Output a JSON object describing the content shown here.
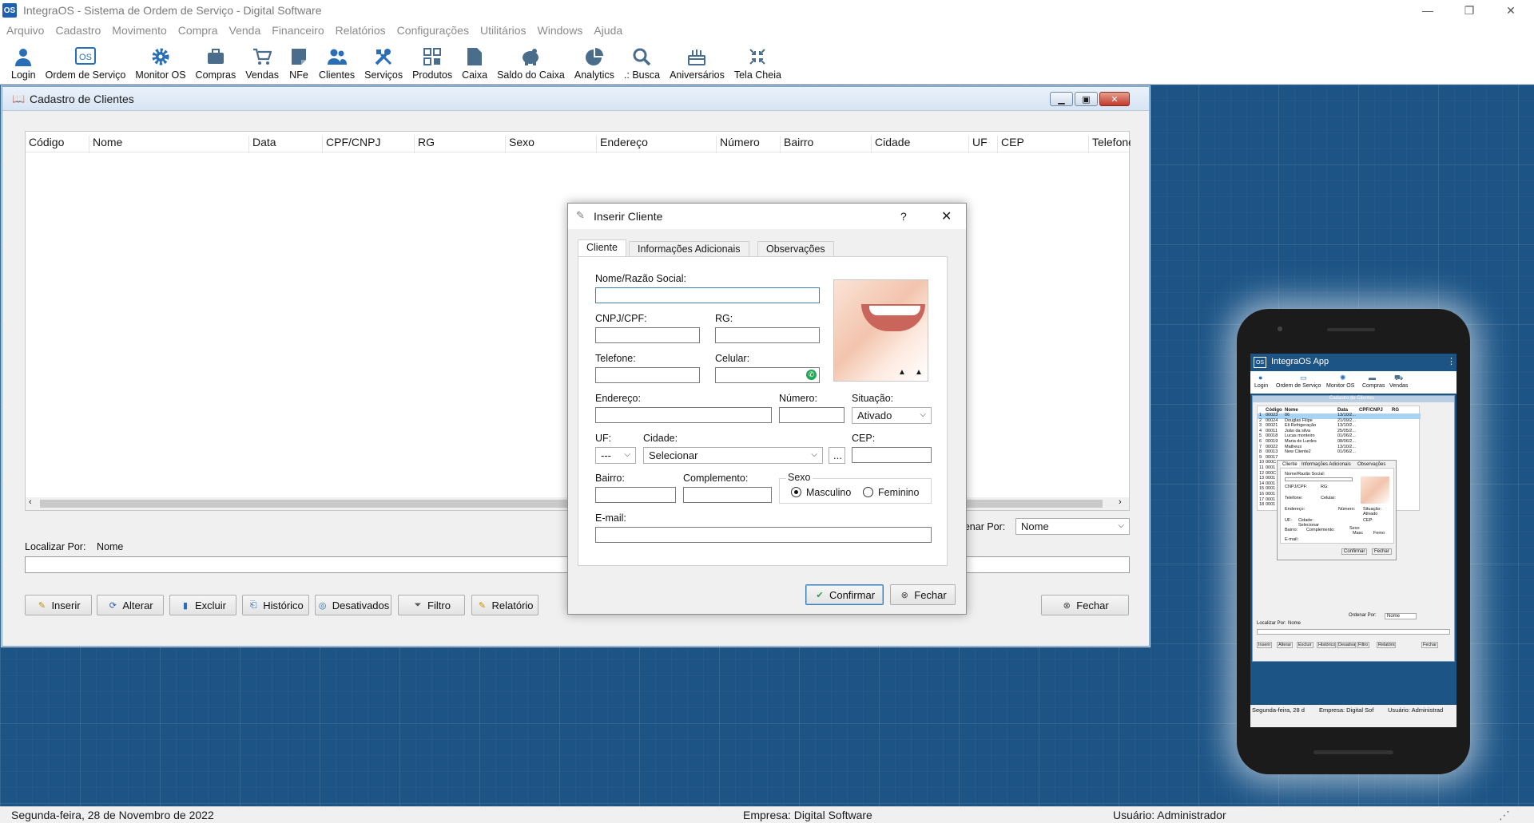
{
  "app": {
    "icon_text": "OS",
    "title": "IntegraOS - Sistema de Ordem de Serviço - Digital Software",
    "window_controls": {
      "minimize": "—",
      "restore": "❐",
      "close": "✕"
    }
  },
  "menu": [
    "Arquivo",
    "Cadastro",
    "Movimento",
    "Compra",
    "Venda",
    "Financeiro",
    "Relatórios",
    "Configurações",
    "Utilitários",
    "Windows",
    "Ajuda"
  ],
  "toolbar": [
    {
      "label": "Login",
      "icon": "user-icon"
    },
    {
      "label": "Ordem de Serviço",
      "icon": "os-icon"
    },
    {
      "label": "Monitor OS",
      "icon": "gear-icon"
    },
    {
      "label": "Compras",
      "icon": "briefcase-icon"
    },
    {
      "label": "Vendas",
      "icon": "cart-icon"
    },
    {
      "label": "NFe",
      "icon": "note-icon"
    },
    {
      "label": "Clientes",
      "icon": "users-icon"
    },
    {
      "label": "Serviços",
      "icon": "tools-icon"
    },
    {
      "label": "Produtos",
      "icon": "grid-icon"
    },
    {
      "label": "Caixa",
      "icon": "file-icon"
    },
    {
      "label": "Saldo do Caixa",
      "icon": "piggy-icon"
    },
    {
      "label": "Analytics",
      "icon": "pie-chart-icon"
    },
    {
      "label": ".: Busca",
      "icon": "search-icon"
    },
    {
      "label": "Aniversários",
      "icon": "cake-icon"
    },
    {
      "label": "Tela Cheia",
      "icon": "fullscreen-icon"
    }
  ],
  "clientes_window": {
    "title": "Cadastro de Clientes",
    "columns": [
      "Código",
      "Nome",
      "Data",
      "CPF/CNPJ",
      "RG",
      "Sexo",
      "Endereço",
      "Número",
      "Bairro",
      "Cidade",
      "UF",
      "CEP",
      "Telefone"
    ],
    "localizar_label": "Localizar Por:",
    "localizar_value": "Nome",
    "ordenar_label": "Ordenar Por:",
    "ordenar_value": "Nome",
    "buttons": {
      "inserir": "Inserir",
      "alterar": "Alterar",
      "excluir": "Excluir",
      "historico": "Histórico",
      "desativados": "Desativados",
      "filtro": "Filtro",
      "relatorio": "Relatório",
      "fechar": "Fechar"
    }
  },
  "dialog": {
    "title": "Inserir Cliente",
    "help": "?",
    "close": "✕",
    "tabs": [
      "Cliente",
      "Informações Adicionais",
      "Observações"
    ],
    "labels": {
      "nome": "Nome/Razão Social:",
      "cnpj": "CNPJ/CPF:",
      "rg": "RG:",
      "telefone": "Telefone:",
      "celular": "Celular:",
      "endereco": "Endereço:",
      "numero": "Número:",
      "situacao": "Situação:",
      "uf": "UF:",
      "cidade": "Cidade:",
      "cep": "CEP:",
      "bairro": "Bairro:",
      "complemento": "Complemento:",
      "sexo": "Sexo",
      "masculino": "Masculino",
      "feminino": "Feminino",
      "email": "E-mail:"
    },
    "situacao_value": "Ativado",
    "uf_value": "---",
    "cidade_value": "Selecionar",
    "ellipsis": "...",
    "sexo_selected": "Masculino",
    "confirmar": "Confirmar",
    "fechar": "Fechar"
  },
  "phone": {
    "app_title": "IntegraOS App",
    "toolbar": [
      "Login",
      "Ordem de Serviço",
      "Monitor OS",
      "Compras",
      "Vendas"
    ],
    "window_title": "Cadastro de Clientes",
    "columns": [
      "Código",
      "Nome",
      "Data",
      "CPF/CNPJ",
      "RG"
    ],
    "rows": [
      [
        "1",
        "00023",
        "06",
        "13/10/2..."
      ],
      [
        "2",
        "00024",
        "Douglas Filipe",
        "21/09/2..."
      ],
      [
        "3",
        "00021",
        "Eli Refrigeração",
        "13/10/2..."
      ],
      [
        "4",
        "00011",
        "João da silva",
        "25/05/2..."
      ],
      [
        "5",
        "00018",
        "Lucas monteiro",
        "01/06/2..."
      ],
      [
        "6",
        "00019",
        "Maria de Lurdes",
        "08/06/2..."
      ],
      [
        "7",
        "00022",
        "Matheus",
        "13/10/2..."
      ],
      [
        "8",
        "00013",
        "New Cliente2",
        "01/06/2..."
      ],
      [
        "9",
        "00017",
        "",
        ""
      ],
      [
        "10",
        "000C",
        "",
        ""
      ],
      [
        "11",
        "0001",
        "",
        ""
      ],
      [
        "12",
        "000C",
        "",
        ""
      ],
      [
        "13",
        "0001",
        "",
        ""
      ],
      [
        "14",
        "0001",
        "",
        ""
      ],
      [
        "15",
        "0001",
        "",
        ""
      ],
      [
        "16",
        "0001",
        "",
        ""
      ],
      [
        "17",
        "0001",
        "",
        ""
      ],
      [
        "18",
        "0001",
        "",
        ""
      ]
    ],
    "tabs": [
      "Cliente",
      "Informações Adicionais",
      "Observações"
    ],
    "labels": [
      "Nome/Razão Social:",
      "CNPJ/CPF:",
      "RG:",
      "Telefone:",
      "Celular:",
      "Endereço:",
      "Número:",
      "Situação:",
      "Ativado",
      "UF:",
      "Cidade:",
      "CEP:",
      "Selecionar",
      "Bairro:",
      "Complemento:",
      "Sexo",
      "Masc",
      "Femo",
      "E-mail:"
    ],
    "confirmar": "Confirmar",
    "fechar": "Fechar",
    "ordenar_label": "Ordenar Por:",
    "ordenar_value": "Nome",
    "localizar_label": "Localizar Por:",
    "localizar_value": "Nome",
    "buttons": [
      "Inserir",
      "Alterar",
      "Excluir",
      "Histórico",
      "Desativados",
      "Filtro",
      "Relatório",
      "Fechar"
    ],
    "status": [
      "Segunda-feira, 28 d",
      "Empresa: Digital Sof",
      "Usuário: Administrad"
    ]
  },
  "status": {
    "date": "Segunda-feira, 28 de Novembro de 2022",
    "empresa": "Empresa: Digital Software",
    "usuario": "Usuário: Administrador"
  },
  "colors": {
    "accent": "#1f5fb0",
    "desktop": "#1c5486",
    "title_gradient": "#d7e4f2"
  }
}
